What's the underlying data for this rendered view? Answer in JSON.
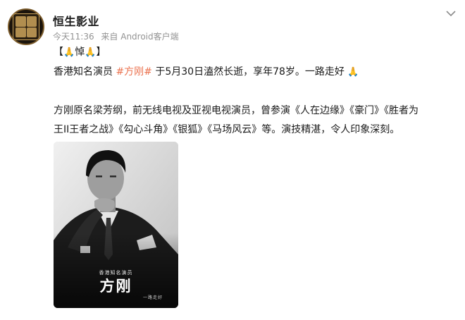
{
  "post": {
    "author": "恒生影业",
    "time": "今天11:36",
    "source": "来自 Android客户端",
    "line1": {
      "open": "【",
      "emoji_a": "🙏",
      "word": "悼",
      "emoji_b": "🙏",
      "close": "】"
    },
    "line2": {
      "before": "香港知名演员 ",
      "hashtag": "#方刚#",
      "after": " 于5月30日溘然长逝，享年78岁。一路走好 ",
      "emoji": "🙏"
    },
    "line3": "方刚原名梁芳纲，前无线电视及亚视电视演员，曾参演《人在边缘》《豪门》《胜者为",
    "line4": "王II王者之战》《勾心斗角》《银狐》《马场风云》等。演技精湛，令人印象深刻。",
    "image": {
      "caption_small": "香港知名演员",
      "caption_big": "方刚",
      "caption_tiny": "一路走好"
    }
  },
  "icons": {
    "avatar": "company-logo-avatar",
    "menu": "chevron-down-icon",
    "emoji": "folded-hands-emoji"
  },
  "colors": {
    "hashtag": "#eb7350",
    "meta": "#939393",
    "text": "#1a1a1a"
  }
}
